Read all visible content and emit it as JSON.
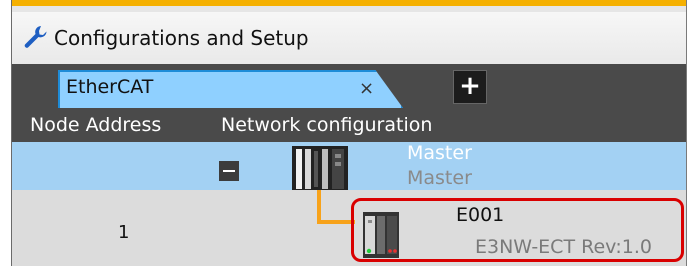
{
  "panel": {
    "title": "Configurations and Setup",
    "icon": "wrench-icon"
  },
  "tabs": [
    {
      "label": "EtherCAT",
      "close_symbol": "×"
    }
  ],
  "add_tab_symbol": "+",
  "columns": {
    "node_address": "Node Address",
    "network_configuration": "Network configuration"
  },
  "master": {
    "name": "Master",
    "model": "Master",
    "collapse_icon": "minus-icon"
  },
  "slaves": [
    {
      "node_address": "1",
      "name": "E001",
      "model": "E3NW-ECT Rev:1.0",
      "highlight_color": "#d90000"
    }
  ],
  "colors": {
    "accent": "#f5b000",
    "tab_active": "#8fd0ff",
    "master_row": "#a3d1f3",
    "connector": "#f7a21a"
  }
}
